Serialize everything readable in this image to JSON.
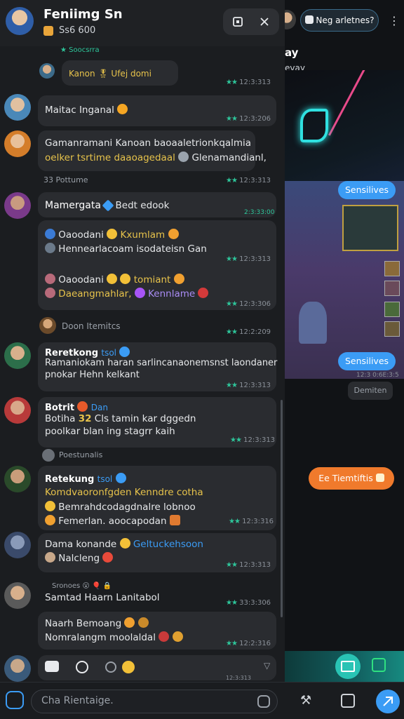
{
  "header": {
    "title": "Feniimg Sn",
    "subtitle": "Ss6 600",
    "close_label": "✕",
    "square_label": "▢"
  },
  "right_panel": {
    "search_pill": "Neg arletnes?",
    "partial_title": "ay",
    "partial_sub": "evay",
    "pill_top": "Sensilives",
    "pill_mid": "Sensilives",
    "meta_1": "12:3 0:6E:3:5",
    "meta_2": "Demiten",
    "orange_pill": "Ee Tiemtiftis"
  },
  "messages": {
    "m0": {
      "badge": "Soocsrra",
      "text": "Kanon 🎖 Ufej domi",
      "time": "12:3:313"
    },
    "m1": {
      "text": "Maitac Inganal",
      "time": "12:3:206"
    },
    "m2": {
      "line1": "Gamanramani Kanoan baoaaletrionkqalmia",
      "line2": "oelker tsrtime daaoagedaal",
      "line2b": "Glenamandianl,",
      "time": "12:3:313"
    },
    "sys1": {
      "text": "33 Pottume"
    },
    "m3": {
      "name": "Mamergata",
      "name2": "Bedt edook",
      "time_top": "2:3:33:00"
    },
    "m3b": {
      "r1": "Oaoodani",
      "r1b": "Kxumlam",
      "r2": "Hennearlacoam isodateisn Gan",
      "r3": "Oaoodani",
      "r3b": "tomiant",
      "r4": "Daeangmahlar,",
      "r4b": "Kennlame",
      "time1": "12:3:313",
      "time2": "12:3:306"
    },
    "sys2": {
      "text": "Doon Itemitcs",
      "time": "12:2:209"
    },
    "m4": {
      "name": "Reretkong",
      "tag": "tsol",
      "line1": "Ramaniokam haran sarlincanaonemsnst laondaner",
      "line2": "pnokar Hehn kelkant",
      "time": "12:3:313"
    },
    "m5": {
      "name": "Botrit",
      "tag": "Dan",
      "line1a": "Botiha",
      "line1b": "32",
      "line1c": "Cls tamin kar dggedn",
      "line2": "poolkar blan ing stagrr kaih",
      "time": "12:3:313"
    },
    "sys3": {
      "text": "Poestunalis"
    },
    "m6": {
      "name": "Retekung",
      "tag": "tsol",
      "line1": "Komdvaoronfgden Kenndre cotha",
      "line2": "Bemrahdcodagdnalre lobnoo",
      "line3": "Femerlan. aoocapodan",
      "time": "12:3:316"
    },
    "m7": {
      "name": "Dama konande",
      "name2": "Geltuckehsoon",
      "line2": "Nalcleng",
      "time": "12:3:313"
    },
    "m8": {
      "badge": "Sronoes 😮 🎈 🔒",
      "text": "Samtad Haarn Lanitabol",
      "time": "33:3:306"
    },
    "m9": {
      "line1": "Naarh Bemoang",
      "line2": "Nomralangm moolaldal",
      "time": "12:2:316"
    }
  },
  "composer": {
    "placeholder": "Cha Rientaige.",
    "time": "12:3:313"
  },
  "colors": {
    "bg": "#1b1d20",
    "bubble": "#2a2c30",
    "accent_blue": "#3b9cf5",
    "accent_orange": "#f07a2c",
    "accent_teal": "#29c3b4",
    "check_green": "#2ec59a"
  },
  "icons": [
    "square-icon",
    "close-icon",
    "emoji-icon",
    "camera-icon",
    "send-icon",
    "wrench-icon",
    "share-icon",
    "image-icon"
  ]
}
